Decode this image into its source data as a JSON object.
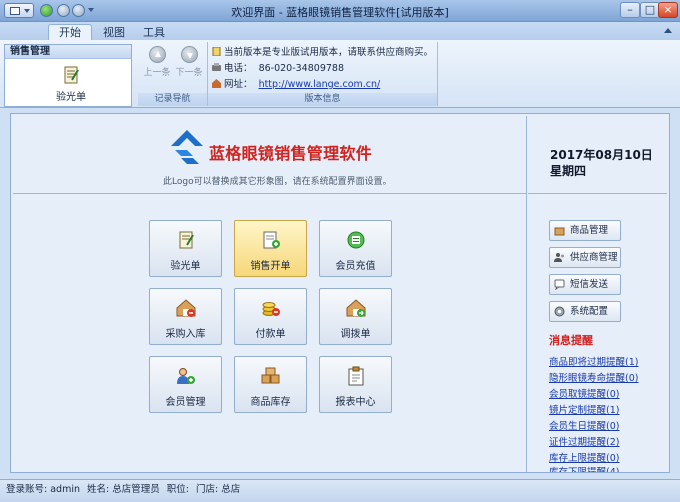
{
  "window": {
    "title": "欢迎界面 - 蓝格眼镜销售管理软件[试用版本]"
  },
  "tabs": [
    {
      "label": "开始"
    },
    {
      "label": "视图"
    },
    {
      "label": "工具"
    }
  ],
  "nav_panel": {
    "header": "销售管理",
    "item": "验光单"
  },
  "record_nav": {
    "prev": "上一条",
    "next": "下一条",
    "group_label": "记录导航"
  },
  "version_info": {
    "notice": "当前版本是专业版试用版本，请联系供应商购买。",
    "phone_label": "电话：",
    "phone": "86-020-34809788",
    "site_label": "网址：",
    "site": "http://www.lange.com.cn/",
    "group_label": "版本信息"
  },
  "logo": {
    "name": "蓝格眼镜销售管理软件",
    "hint": "此Logo可以替换成其它形象图，请在系统配置界面设置。"
  },
  "date": {
    "day": "2017年08月10日",
    "weekday": "星期四"
  },
  "tiles": [
    {
      "label": "验光单",
      "icon": "prescription-icon"
    },
    {
      "label": "销售开单",
      "icon": "sales-order-icon",
      "active": true
    },
    {
      "label": "会员充值",
      "icon": "recharge-icon"
    },
    {
      "label": "采购入库",
      "icon": "purchase-icon"
    },
    {
      "label": "付款单",
      "icon": "payment-icon"
    },
    {
      "label": "调拨单",
      "icon": "transfer-icon"
    },
    {
      "label": "会员管理",
      "icon": "members-icon"
    },
    {
      "label": "商品库存",
      "icon": "inventory-icon"
    },
    {
      "label": "报表中心",
      "icon": "report-icon"
    }
  ],
  "side_buttons": [
    {
      "label": "商品管理"
    },
    {
      "label": "供应商管理"
    },
    {
      "label": "短信发送"
    },
    {
      "label": "系统配置"
    }
  ],
  "messages": {
    "title": "消息提醒",
    "items": [
      "商品即将过期提醒(1)",
      "隐形眼镜寿命提醒(0)",
      "会员取镜提醒(0)",
      "镜片定制提醒(1)",
      "会员生日提醒(0)",
      "证件过期提醒(2)",
      "库存上限提醒(0)",
      "库存下限提醒(4)"
    ]
  },
  "status": {
    "account": "登录账号: admin",
    "name": "姓名: 总店管理员",
    "role": "职位:",
    "store": "门店: 总店"
  },
  "colors": {
    "accent": "#d0221f",
    "link": "#1a3aa8",
    "ribbon": "#d5e4f6"
  }
}
